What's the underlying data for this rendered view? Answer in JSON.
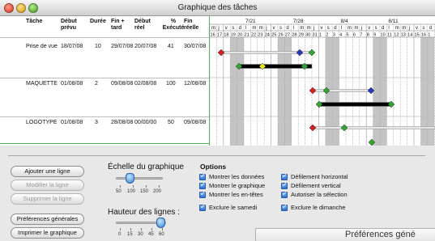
{
  "window": {
    "title": "Graphique des tâches"
  },
  "table": {
    "headers": {
      "tache": "Tâche",
      "debut_prevu": "Début prévu",
      "duree": "Durée",
      "fin_plus_tard": "Fin + tard",
      "debut_reel": "Début réel",
      "pct_execute": "% Exécuté",
      "fin_reelle": "Fin réelle"
    },
    "rows": [
      {
        "tache": "Prise de vue",
        "debut_prevu": "18/07/08",
        "duree": "10",
        "fin_plus_tard": "29/07/08",
        "debut_reel": "20/07/08",
        "pct_execute": "41",
        "fin_reelle": "30/07/08"
      },
      {
        "tache": "MAQUETTE",
        "debut_prevu": "01/08/08",
        "duree": "2",
        "fin_plus_tard": "09/08/08",
        "debut_reel": "02/08/08",
        "pct_execute": "100",
        "fin_reelle": "12/08/08"
      },
      {
        "tache": "LOGOTYPE",
        "debut_prevu": "01/08/08",
        "duree": "3",
        "fin_plus_tard": "28/08/08",
        "debut_reel": "00/00/00",
        "pct_execute": "50",
        "fin_reelle": "09/08/08"
      }
    ]
  },
  "gantt": {
    "weeks": [
      "7/21",
      "7/28",
      "8/4",
      "8/11"
    ],
    "day_letters": [
      "m",
      "j",
      "v",
      "s",
      "d",
      "l",
      "m",
      "m",
      "j",
      "v",
      "s",
      "d",
      "l",
      "m",
      "m",
      "j",
      "v",
      "s",
      "d",
      "l",
      "m",
      "m",
      "j",
      "v",
      "s",
      "d",
      "l",
      "m",
      "m",
      "j",
      "v",
      "s",
      "d"
    ],
    "day_numbers": [
      "16",
      "17",
      "18",
      "19",
      "20",
      "21",
      "22",
      "23",
      "24",
      "25",
      "26",
      "27",
      "28",
      "29",
      "30",
      "31",
      "1",
      "2",
      "3",
      "4",
      "5",
      "6",
      "7",
      "8",
      "9",
      "10",
      "11",
      "12",
      "13",
      "14",
      "15",
      "16",
      "1"
    ],
    "colors": {
      "red": "#d42020",
      "green": "#2fa52f",
      "blue": "#2438c0",
      "yellow": "#e8e020",
      "bar": "#000000"
    }
  },
  "buttons": {
    "add_line": "Ajouter une ligne",
    "edit_line": "Modifier la ligne",
    "delete_line": "Supprimer la ligne",
    "general_prefs": "Préférences générales",
    "print_chart": "Imprimer le graphique"
  },
  "scale": {
    "title": "Échelle du graphique",
    "ticks": [
      "50",
      "100",
      "150",
      "200"
    ],
    "value": "100"
  },
  "line_height": {
    "title": "Hauteur des lignes :",
    "ticks": [
      "0",
      "15",
      "30",
      "45",
      "60"
    ],
    "value": "60"
  },
  "options": {
    "title": "Options",
    "left": [
      "Montrer les données",
      "Montrer le graphique",
      "Montrer les en-têtes",
      "Exclure le samedi"
    ],
    "right": [
      "Défilement horizontal",
      "Défilement vertical",
      "Autoriser la sélection",
      "Exclure le dimanche"
    ]
  },
  "bottom_panel": {
    "title": "Préférences géné"
  }
}
